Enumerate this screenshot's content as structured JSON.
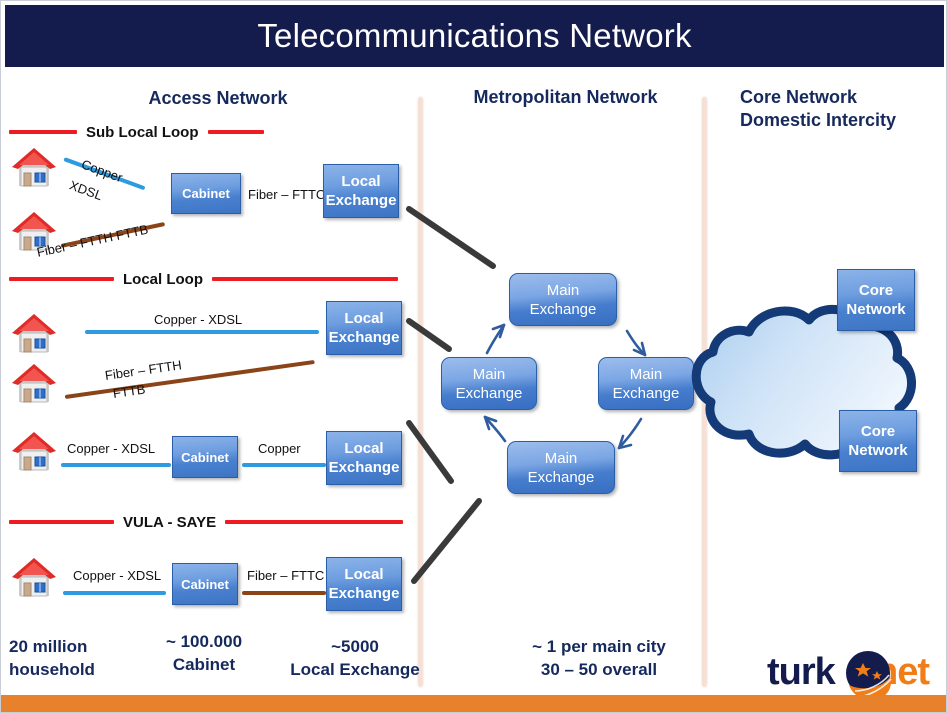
{
  "title": "Telecommunications Network",
  "sections": {
    "access": {
      "label": "Access Network"
    },
    "metro": {
      "label": "Metropolitan Network"
    },
    "core": {
      "label_line1": "Core Network",
      "label_line2": "Domestic Intercity"
    }
  },
  "separators": {
    "sub_local_loop": "Sub Local Loop",
    "local_loop": "Local Loop",
    "vula_saye": "VULA - SAYE"
  },
  "boxes": {
    "cabinet": "Cabinet",
    "local_exchange_line1": "Local",
    "local_exchange_line2": "Exchange",
    "main_exchange_line1": "Main",
    "main_exchange_line2": "Exchange",
    "core_network_line1": "Core",
    "core_network_line2": "Network"
  },
  "cables": {
    "copper": "Copper",
    "xdsl": "XDSL",
    "copper_xdsl": "Copper - XDSL",
    "fiber_ftth_fttb": "Fiber – FTTH  FTTB",
    "fiber_ftth": "Fiber – FTTH",
    "fttb": "FTTB",
    "fiber_fttc": "Fiber – FTTC"
  },
  "stats": {
    "household_line1": "20 million",
    "household_line2": "household",
    "cabinet_line1": "~ 100.000",
    "cabinet_line2": "Cabinet",
    "exchange_line1": "~5000",
    "exchange_line2": "Local Exchange",
    "metro_line1": "~ 1 per main city",
    "metro_line2": "30 – 50 overall"
  },
  "logo": {
    "word1": "turk",
    "word2": "net"
  },
  "colors": {
    "title_bg": "#141B4D",
    "accent_orange": "#E8812B",
    "separator_red": "#EE1C22",
    "copper_blue": "#2E9BE0",
    "fiber_brown": "#8A4418",
    "box_blue": "#4A81CF",
    "heading_navy": "#16295C"
  }
}
